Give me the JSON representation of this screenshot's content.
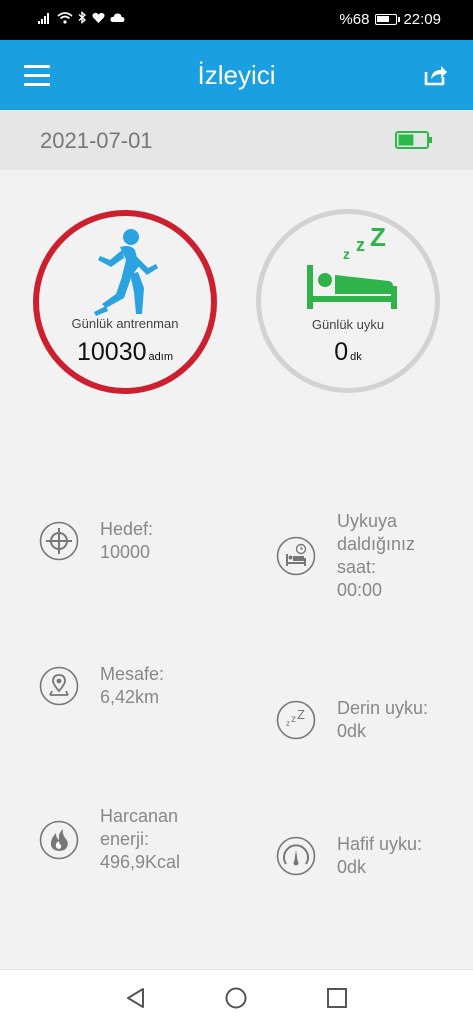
{
  "status_bar": {
    "left_icons": [
      "signal-icon",
      "wifi-icon",
      "bluetooth-icon",
      "heart-icon",
      "cloud-icon"
    ],
    "battery_percent": "%68",
    "battery_level": 0.68,
    "time": "22:09"
  },
  "app_bar": {
    "title": "İzleyici",
    "menu_icon": "hamburger-menu-icon",
    "share_icon": "share-icon",
    "color": "#1aa0e0"
  },
  "date_bar": {
    "date": "2021-07-01",
    "device_battery_icon": "device-battery-icon",
    "device_battery_level": 0.55,
    "battery_color": "#2db84a"
  },
  "activity": {
    "label": "Günlük antrenman",
    "value": "10030",
    "unit": "adım",
    "icon": "running-person-icon",
    "ring_color": "#cc1f2f",
    "icon_color": "#2aa3e0"
  },
  "sleep": {
    "label": "Günlük uyku",
    "value": "0",
    "unit": "dk",
    "icon": "sleeping-bed-icon",
    "ring_color": "#d2d2d2",
    "icon_color": "#2fb34a"
  },
  "stats_left": [
    {
      "icon": "target-icon",
      "lines": [
        "Hedef:",
        "10000"
      ]
    },
    {
      "icon": "location-pin-icon",
      "lines": [
        "Mesafe:",
        "6,42km"
      ]
    },
    {
      "icon": "flame-icon",
      "lines": [
        "Harcanan",
        "enerji:",
        "496,9Kcal"
      ]
    }
  ],
  "stats_right": [
    {
      "icon": "sleep-clock-icon",
      "lines": [
        "Uykuya",
        "daldığınız",
        "saat:",
        "00:00"
      ]
    },
    {
      "icon": "deep-sleep-icon",
      "lines": [
        "Derin uyku:",
        "0dk"
      ]
    },
    {
      "icon": "light-sleep-gauge-icon",
      "lines": [
        "Hafif uyku:",
        "0dk"
      ]
    }
  ],
  "nav_bar": {
    "back": "back-triangle-icon",
    "home": "home-circle-icon",
    "recents": "recents-square-icon"
  }
}
